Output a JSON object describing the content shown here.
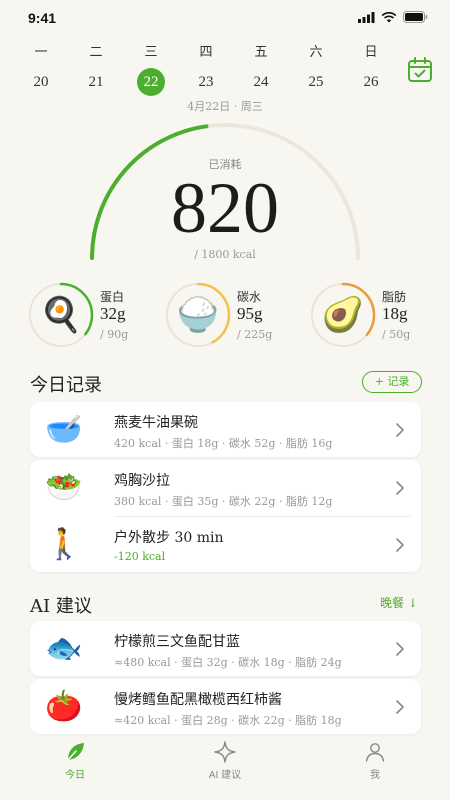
{
  "status": {
    "time": "9:41"
  },
  "week": [
    {
      "weekday": "一",
      "date": "20"
    },
    {
      "weekday": "二",
      "date": "21"
    },
    {
      "weekday": "三",
      "date": "22",
      "active": true
    },
    {
      "weekday": "四",
      "date": "23"
    },
    {
      "weekday": "五",
      "date": "24"
    },
    {
      "weekday": "六",
      "date": "25"
    },
    {
      "weekday": "日",
      "date": "26"
    }
  ],
  "date_line": "4月22日 · 周三",
  "calories": {
    "label": "已消耗",
    "value": "820",
    "goal_text": "/ 1800 kcal",
    "progress": 0.455
  },
  "macros": [
    {
      "name": "蛋白",
      "value": "32g",
      "goal": "/ 90g",
      "emoji": "🍳",
      "progress": 0.356,
      "color": "#4cae2e"
    },
    {
      "name": "碳水",
      "value": "95g",
      "goal": "/ 225g",
      "emoji": "🍚",
      "progress": 0.42,
      "color": "#f0c24a"
    },
    {
      "name": "脂肪",
      "value": "18g",
      "goal": "/ 50g",
      "emoji": "🥑",
      "progress": 0.36,
      "color": "#ec9a3c"
    }
  ],
  "today": {
    "title": "今日记录",
    "add_label": "+ 记录",
    "items": [
      {
        "emoji": "🥣",
        "title": "燕麦牛油果碗",
        "sub": "420 kcal · 蛋白 18g · 碳水 52g · 脂肪 16g"
      },
      {
        "emoji": "🥗",
        "title": "鸡胸沙拉",
        "sub": "380 kcal · 蛋白 35g · 碳水 22g · 脂肪 12g"
      },
      {
        "emoji": "🚶",
        "title": "户外散步 30 min",
        "sub": "-120 kcal"
      }
    ]
  },
  "ai": {
    "title": "AI 建议",
    "meal_label": "晚餐 ↓",
    "items": [
      {
        "emoji": "🐟",
        "title": "柠檬煎三文鱼配甘蓝",
        "sub": "≈480 kcal · 蛋白 32g · 碳水 18g · 脂肪 24g"
      },
      {
        "emoji": "🍅",
        "title": "慢烤鳕鱼配黑橄榄西红柿酱",
        "sub": "≈420 kcal · 蛋白 28g · 碳水 22g · 脂肪 18g"
      }
    ]
  },
  "tabs": [
    {
      "label": "今日",
      "icon": "leaf-icon",
      "active": true
    },
    {
      "label": "AI 建议",
      "icon": "sparkle-icon"
    },
    {
      "label": "我",
      "icon": "person-icon"
    }
  ],
  "colors": {
    "accent": "#4cae2e",
    "background": "#f8f6f1"
  }
}
